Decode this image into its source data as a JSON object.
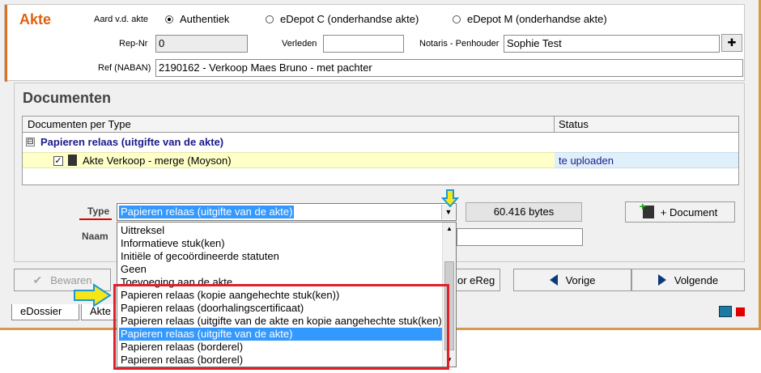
{
  "akte": {
    "title": "Akte",
    "aard_label": "Aard v.d. akte",
    "aard_options": [
      "Authentiek",
      "eDepot C (onderhandse akte)",
      "eDepot M (onderhandse akte)"
    ],
    "rep_label": "Rep-Nr",
    "rep_value": "0",
    "verleden_label": "Verleden",
    "verleden_value": "",
    "notaris_label": "Notaris - Penhouder",
    "notaris_value": "Sophie Test",
    "ref_label": "Ref (NABAN)",
    "ref_value": "2190162 - Verkoop Maes Bruno - met pachter"
  },
  "documents": {
    "title": "Documenten",
    "col_type": "Documenten per Type",
    "col_status": "Status",
    "group_label": "Papieren relaas (uitgifte van de akte)",
    "group_expander": "⊟",
    "row_name": "Akte Verkoop - merge (Moyson)",
    "row_status": "te uploaden",
    "row_checked": "✓"
  },
  "form": {
    "type_label": "Type",
    "naam_label": "Naam",
    "type_value": "Papieren relaas (uitgifte van de akte)",
    "bytes": "60.416 bytes",
    "add_document_label": "+  Document"
  },
  "dropdown": {
    "items": [
      "Uittreksel",
      "Informatieve stuk(ken)",
      "Initiële of gecoördineerde statuten",
      "Geen",
      "Toevoeging aan de akte",
      "Papieren relaas (kopie aangehechte stuk(ken))",
      "Papieren relaas (doorhalingscertificaat)",
      "Papieren relaas (uitgifte van de akte en kopie aangehechte stuk(ken))",
      "Papieren relaas (uitgifte van de akte)",
      "Papieren relaas (borderel)",
      "Papieren relaas (borderel)"
    ],
    "selected_index": 8
  },
  "buttons": {
    "bewaren": "Bewaren",
    "ereg": "or eReg",
    "vorige": "Vorige",
    "volgende": "Volgende"
  },
  "tabs": [
    "eDossier",
    "Akte"
  ],
  "colors": {
    "accent": "#e06010",
    "selection": "#3399ff",
    "highlight": "#e0202a",
    "hint_arrow": "#f5e61a"
  }
}
